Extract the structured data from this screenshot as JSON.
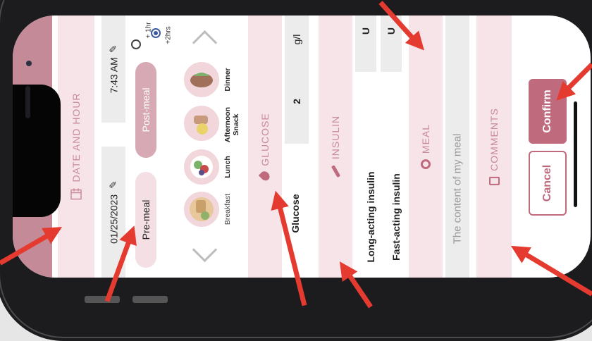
{
  "sections": {
    "date_hour": "DATE AND HOUR",
    "glucose": "GLUCOSE",
    "insulin": "INSULIN",
    "meal": "MEAL",
    "comments": "COMMENTS"
  },
  "datetime": {
    "date": "01/25/2023",
    "time": "7:43 AM"
  },
  "meal_timing": {
    "pre_meal_label": "Pre-meal",
    "post_meal_label": "Post-meal",
    "options": [
      {
        "label": "+ 1hr",
        "selected": false
      },
      {
        "label": "+2hrs",
        "selected": true
      }
    ]
  },
  "meals": [
    {
      "name": "Breakfast",
      "selected": true
    },
    {
      "name": "Lunch",
      "selected": false
    },
    {
      "name": "Afternoon\nSnack",
      "selected": false
    },
    {
      "name": "Dinner",
      "selected": false
    }
  ],
  "glucose": {
    "label": "Glucose",
    "value": "2",
    "unit": "g/l"
  },
  "insulin": {
    "long_label": "Long-acting insulin",
    "fast_label": "Fast-acting insulin",
    "long_unit": "U",
    "fast_unit": "U"
  },
  "comments": {
    "placeholder": "The content of my meal"
  },
  "buttons": {
    "confirm": "Confirm",
    "cancel": "Cancel"
  },
  "colors": {
    "accent": "#c06a7d",
    "section_pink": "#f6e4e8",
    "field_grey": "#ececec",
    "annotation_arrow": "#e53a2f"
  },
  "icons": [
    "calendar-icon",
    "edit-icon",
    "drop-icon",
    "syringe-icon",
    "plate-icon",
    "notes-icon",
    "chevron-up-icon",
    "chevron-down-icon"
  ]
}
